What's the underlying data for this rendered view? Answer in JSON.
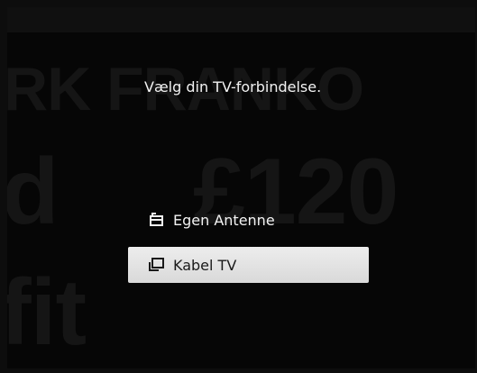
{
  "dialog": {
    "title": "Vælg din TV-forbindelse."
  },
  "options": [
    {
      "label": "Egen Antenne",
      "icon": "antenna-icon",
      "selected": false
    },
    {
      "label": "Kabel TV",
      "icon": "cable-icon",
      "selected": true
    }
  ],
  "background": {
    "ghost_texts": [
      "RK FRANKO",
      "d",
      "£120",
      "fit"
    ]
  },
  "colors": {
    "background": "#060606",
    "text": "#f2f2f2",
    "highlight": "#e6e6e6",
    "highlight_text": "#1a1a1a"
  }
}
